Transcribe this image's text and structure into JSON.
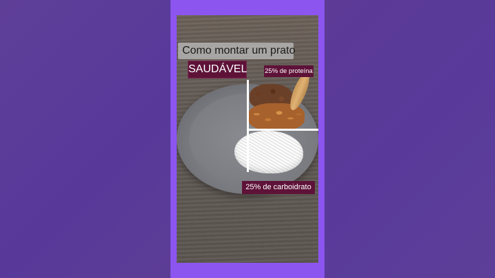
{
  "overlay": {
    "title": "Como montar um prato",
    "subtitle": "SAUDÁVEL",
    "protein_label": "25% de proteína",
    "carb_label": "25% de carboidrato"
  },
  "colors": {
    "background": "#5a3a94",
    "frame": "#8c55f0",
    "label_bg": "#5e1238",
    "title_bg": "#bebebe"
  }
}
